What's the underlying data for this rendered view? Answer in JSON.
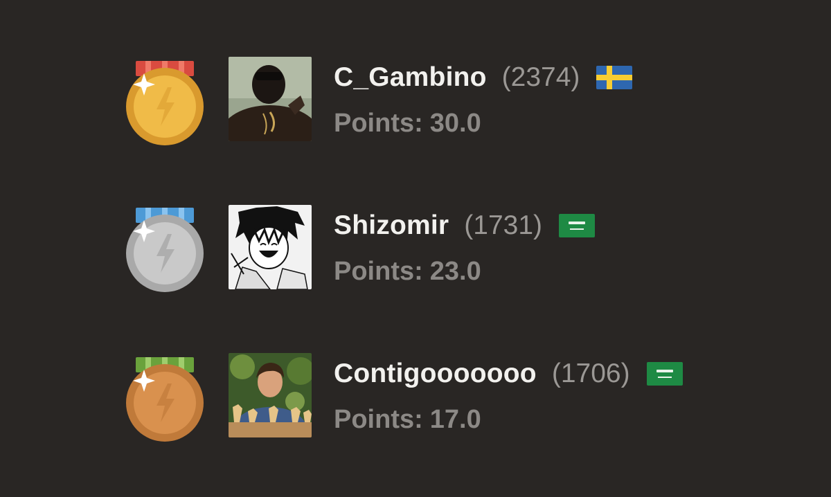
{
  "leaderboard": {
    "points_label": "Points:",
    "players": [
      {
        "rank": 1,
        "medal": "gold-medal-icon",
        "username": "C_Gambino",
        "rating": "(2374)",
        "flag": "sweden-flag-icon",
        "points": "30.0"
      },
      {
        "rank": 2,
        "medal": "silver-medal-icon",
        "username": "Shizomir",
        "rating": "(1731)",
        "flag": "saudi-arabia-flag-icon",
        "points": "23.0"
      },
      {
        "rank": 3,
        "medal": "bronze-medal-icon",
        "username": "Contigooooooo",
        "rating": "(1706)",
        "flag": "saudi-arabia-flag-icon",
        "points": "17.0"
      }
    ]
  },
  "colors": {
    "background": "#292624",
    "username": "#f2f1ee",
    "rating": "#9b9895",
    "points": "#8c8986",
    "gold": "#eab446",
    "silver": "#c9c9c9",
    "bronze": "#d9914e"
  }
}
